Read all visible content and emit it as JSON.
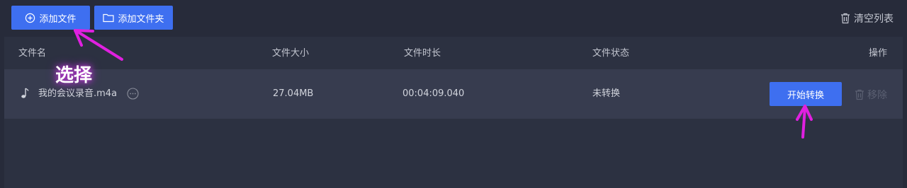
{
  "toolbar": {
    "add_file_label": "添加文件",
    "add_folder_label": "添加文件夹",
    "clear_list_label": "清空列表"
  },
  "table": {
    "columns": [
      "文件名",
      "文件大小",
      "文件时长",
      "文件状态",
      "操作"
    ],
    "rows": [
      {
        "name": "我的会议录音.m4a",
        "size": "27.04MB",
        "duration": "00:04:09.040",
        "status": "未转换",
        "start_label": "开始转换",
        "remove_label": "移除"
      }
    ]
  },
  "annotation": {
    "text": "选择",
    "color": "#e020e0"
  },
  "colors": {
    "accent": "#3e6ff0",
    "background": "#272b3a",
    "row": "#373c4f"
  }
}
